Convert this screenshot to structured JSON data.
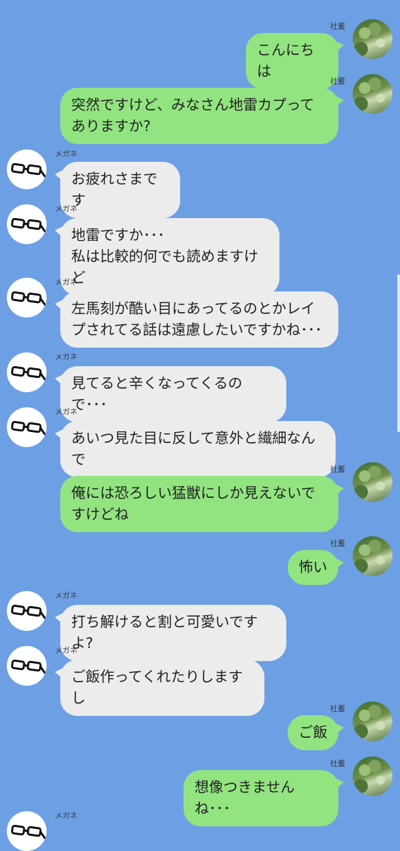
{
  "colors": {
    "background": "#6d9fe4",
    "self_bubble": "#92e480",
    "other_bubble": "#ececec"
  },
  "messages": [
    {
      "sender": "社蓄",
      "side": "right",
      "avatar_icon": "forest-photo-icon",
      "text": "こんにちは"
    },
    {
      "sender": "社蓄",
      "side": "right",
      "avatar_icon": "forest-photo-icon",
      "text": "突然ですけど、みなさん地雷カプってありますか?"
    },
    {
      "sender": "メガネ",
      "side": "left",
      "avatar_icon": "glasses-icon",
      "text": "お疲れさまです"
    },
    {
      "sender": "メガネ",
      "side": "left",
      "avatar_icon": "glasses-icon",
      "text": "地雷ですか･･･\n私は比較的何でも読めますけど"
    },
    {
      "sender": "メガネ",
      "side": "left",
      "avatar_icon": "glasses-icon",
      "text": "左馬刻が酷い目にあってるのとかレイプされてる話は遠慮したいですかね･･･"
    },
    {
      "sender": "メガネ",
      "side": "left",
      "avatar_icon": "glasses-icon",
      "text": "見てると辛くなってくるので･･･"
    },
    {
      "sender": "メガネ",
      "side": "left",
      "avatar_icon": "glasses-icon",
      "text": "あいつ見た目に反して意外と繊細なんで"
    },
    {
      "sender": "社蓄",
      "side": "right",
      "avatar_icon": "forest-photo-icon",
      "text": "俺には恐ろしい猛獣にしか見えないですけどね"
    },
    {
      "sender": "社蓄",
      "side": "right",
      "avatar_icon": "forest-photo-icon",
      "text": "怖い"
    },
    {
      "sender": "メガネ",
      "side": "left",
      "avatar_icon": "glasses-icon",
      "text": "打ち解けると割と可愛いですよ?"
    },
    {
      "sender": "メガネ",
      "side": "left",
      "avatar_icon": "glasses-icon",
      "text": "ご飯作ってくれたりしますし"
    },
    {
      "sender": "社蓄",
      "side": "right",
      "avatar_icon": "forest-photo-icon",
      "text": "ご飯"
    },
    {
      "sender": "社蓄",
      "side": "right",
      "avatar_icon": "forest-photo-icon",
      "text": "想像つきませんね･･･"
    },
    {
      "sender": "メガネ",
      "side": "left",
      "avatar_icon": "glasses-icon",
      "text": ""
    }
  ]
}
